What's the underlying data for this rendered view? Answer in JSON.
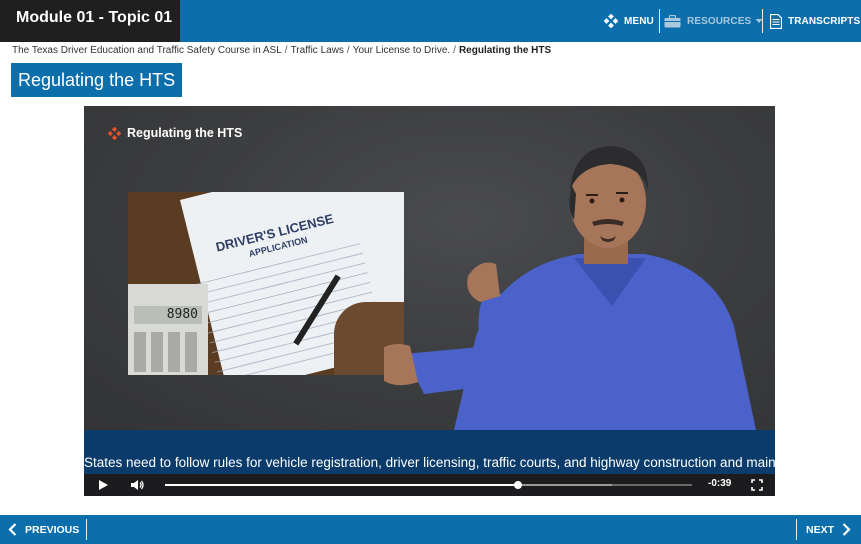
{
  "header": {
    "module_title": "Module 01 - Topic 01",
    "menu_label": "MENU",
    "resources_label": "RESOURCES",
    "transcripts_label": "TRANSCRIPTS"
  },
  "breadcrumb": {
    "items": [
      "The Texas Driver Education and Traffic Safety Course in ASL",
      "Traffic Laws",
      "Your License to Drive."
    ],
    "current": "Regulating the HTS"
  },
  "page": {
    "title": "Regulating the HTS"
  },
  "video": {
    "slide_label": "Regulating the HTS",
    "photo_title_line1": "DRIVER'S LICENSE",
    "photo_title_line2": "APPLICATION",
    "calculator_display": "8980",
    "caption": "States need to follow rules for vehicle registration, driver licensing, traffic courts, and highway construction and maintenance.",
    "time_remaining": "-0:39",
    "progress_fraction": 0.669,
    "buffered_fraction": 0.848
  },
  "footer": {
    "previous_label": "PREVIOUS",
    "next_label": "NEXT"
  },
  "colors": {
    "brand_blue": "#0c6fab",
    "title_dark": "#1f1f1f",
    "accent_orange": "#e8502b",
    "caption_bar": "#083c6e"
  },
  "icons": {
    "menu": "diamond-cluster-icon",
    "resources": "briefcase-icon",
    "transcripts": "document-icon",
    "play": "play-icon",
    "volume": "volume-icon",
    "fullscreen": "fullscreen-icon",
    "previous": "chevron-left-icon",
    "next": "chevron-right-icon"
  }
}
